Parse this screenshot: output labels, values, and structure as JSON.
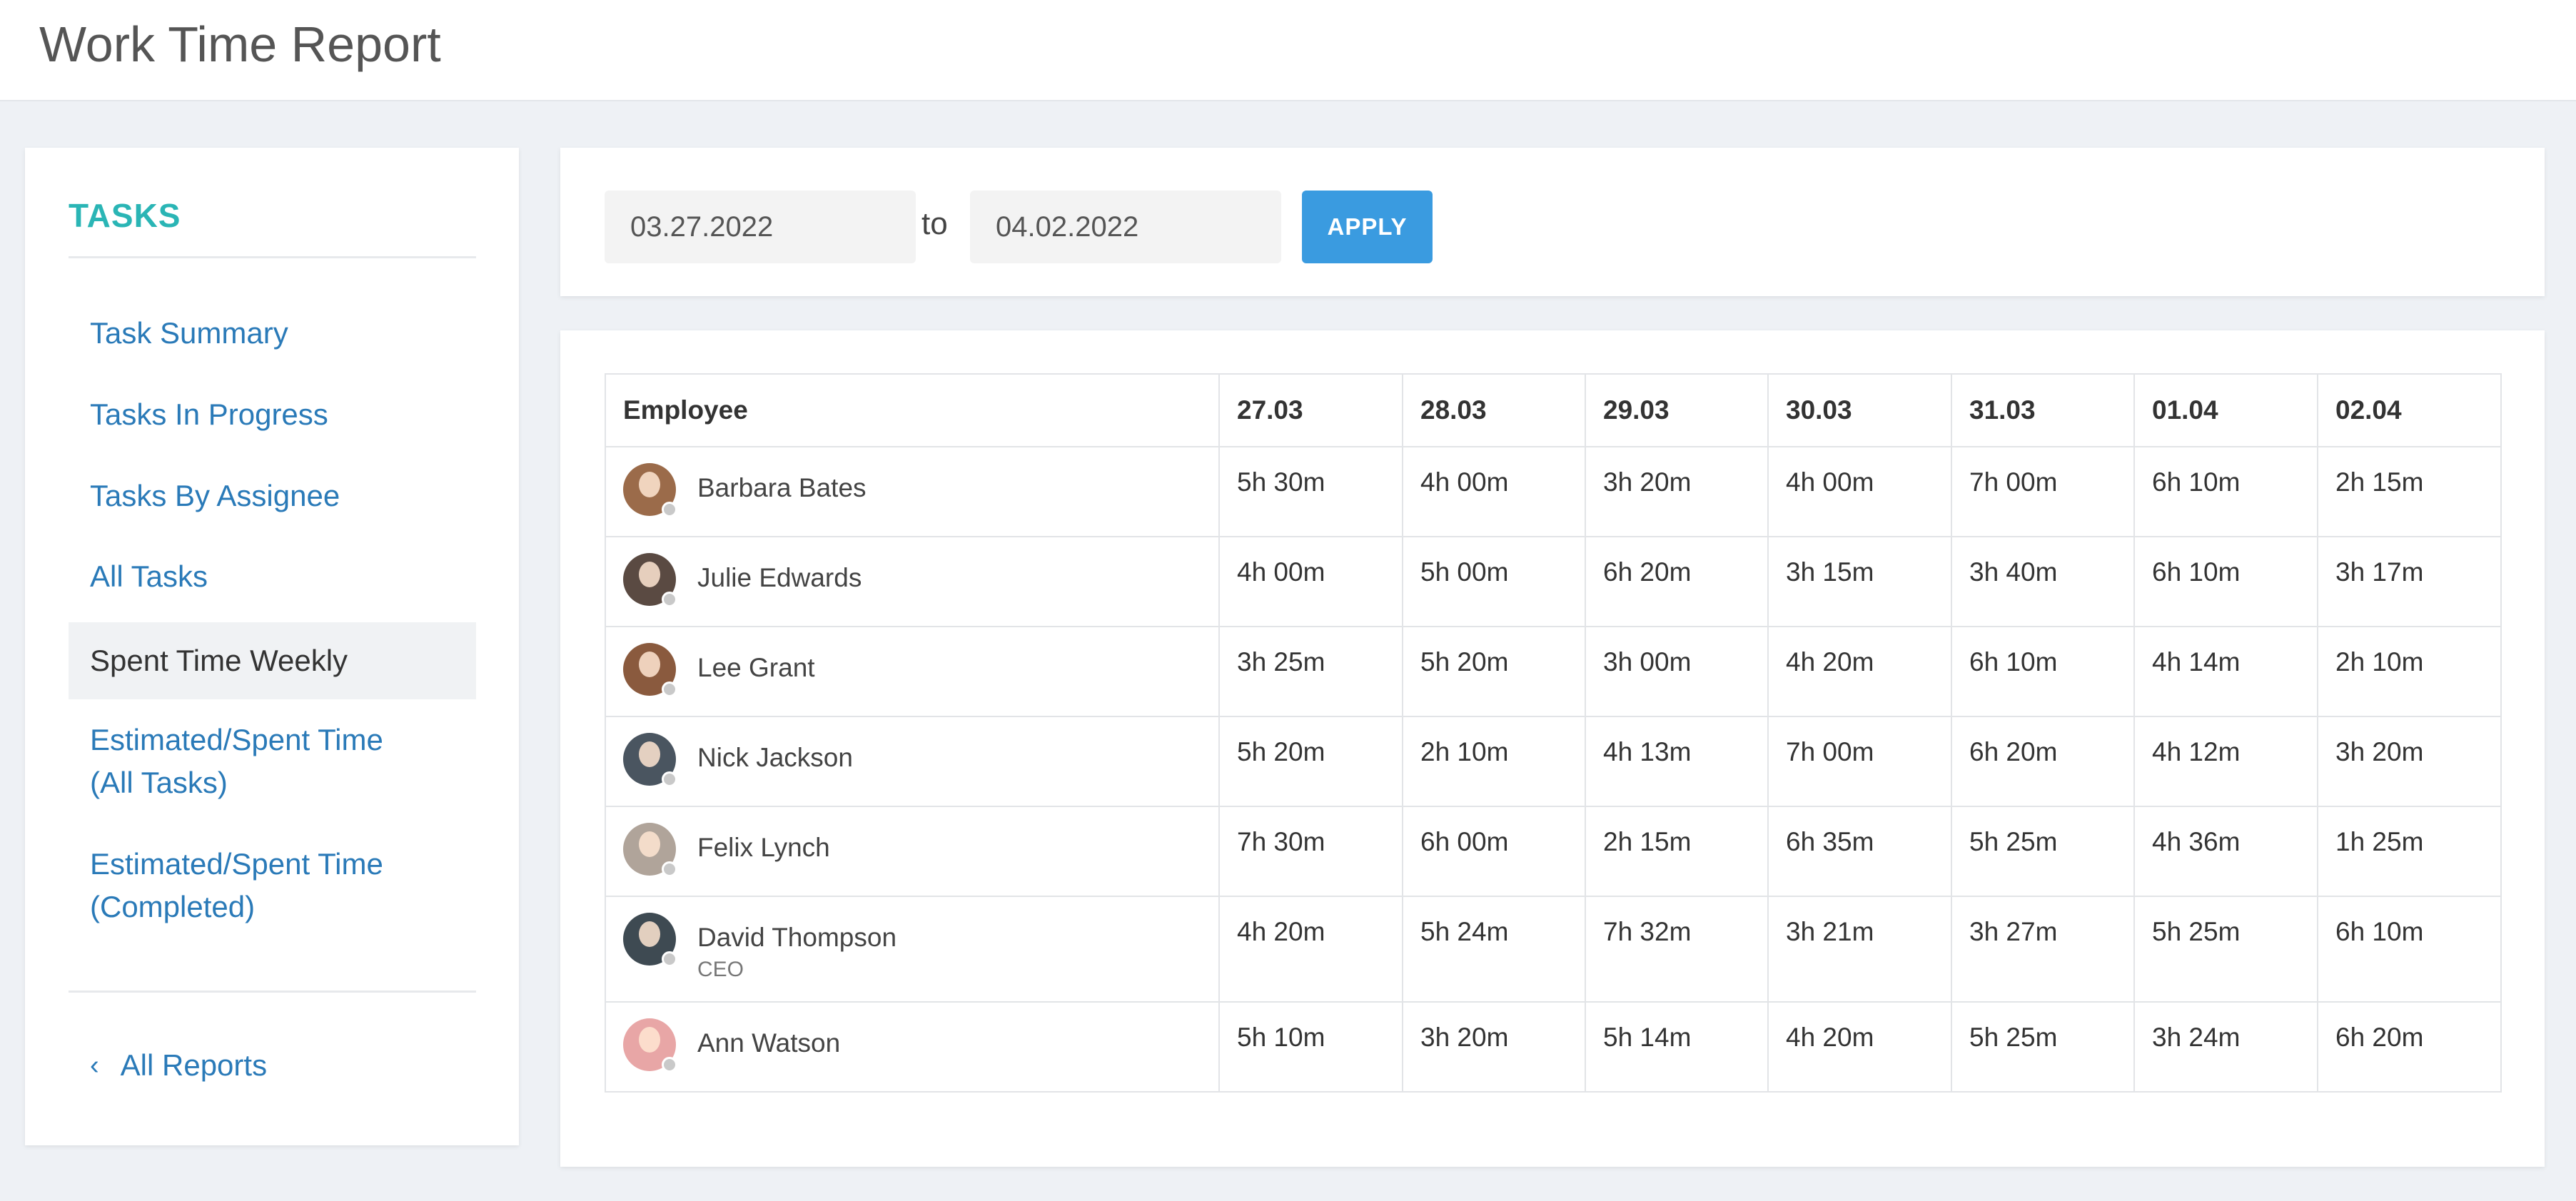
{
  "header": {
    "title": "Work Time Report"
  },
  "sidebar": {
    "title": "TASKS",
    "items": [
      {
        "label": "Task Summary",
        "active": false
      },
      {
        "label": "Tasks In Progress",
        "active": false
      },
      {
        "label": "Tasks By Assignee",
        "active": false
      },
      {
        "label": "All Tasks",
        "active": false
      },
      {
        "label": "Spent Time Weekly",
        "active": true
      },
      {
        "label_line1": "Estimated/Spent Time",
        "label_line2": "(All Tasks)",
        "active": false
      },
      {
        "label_line1": "Estimated/Spent Time",
        "label_line2": "(Completed)",
        "active": false
      }
    ],
    "back_link": "All Reports"
  },
  "filter": {
    "from": "03.27.2022",
    "to_label": "to",
    "to": "04.02.2022",
    "apply_label": "APPLY"
  },
  "table": {
    "columns": [
      "Employee",
      "27.03",
      "28.03",
      "29.03",
      "30.03",
      "31.03",
      "01.04",
      "02.04"
    ],
    "rows": [
      {
        "name": "Barbara Bates",
        "role": "",
        "avatar_color": "#9b6b4a",
        "values": [
          "5h 30m",
          "4h 00m",
          "3h 20m",
          "4h 00m",
          "7h 00m",
          "6h 10m",
          "2h 15m"
        ]
      },
      {
        "name": "Julie Edwards",
        "role": "",
        "avatar_color": "#5a4a42",
        "values": [
          "4h 00m",
          "5h 00m",
          "6h 20m",
          "3h 15m",
          "3h 40m",
          "6h 10m",
          "3h 17m"
        ]
      },
      {
        "name": "Lee Grant",
        "role": "",
        "avatar_color": "#8a5a3e",
        "values": [
          "3h 25m",
          "5h 20m",
          "3h 00m",
          "4h 20m",
          "6h 10m",
          "4h 14m",
          "2h 10m"
        ]
      },
      {
        "name": "Nick Jackson",
        "role": "",
        "avatar_color": "#4a5560",
        "values": [
          "5h 20m",
          "2h 10m",
          "4h 13m",
          "7h 00m",
          "6h 20m",
          "4h 12m",
          "3h 20m"
        ]
      },
      {
        "name": "Felix Lynch",
        "role": "",
        "avatar_color": "#b0a49a",
        "values": [
          "7h 30m",
          "6h 00m",
          "2h 15m",
          "6h 35m",
          "5h 25m",
          "4h 36m",
          "1h 25m"
        ]
      },
      {
        "name": "David Thompson",
        "role": "CEO",
        "avatar_color": "#3e4a52",
        "values": [
          "4h 20m",
          "5h 24m",
          "7h 32m",
          "3h 21m",
          "3h 27m",
          "5h 25m",
          "6h 10m"
        ]
      },
      {
        "name": "Ann Watson",
        "role": "",
        "avatar_color": "#e8a6a6",
        "values": [
          "5h 10m",
          "3h 20m",
          "5h 14m",
          "4h 20m",
          "5h 25m",
          "3h 24m",
          "6h 20m"
        ]
      }
    ]
  }
}
